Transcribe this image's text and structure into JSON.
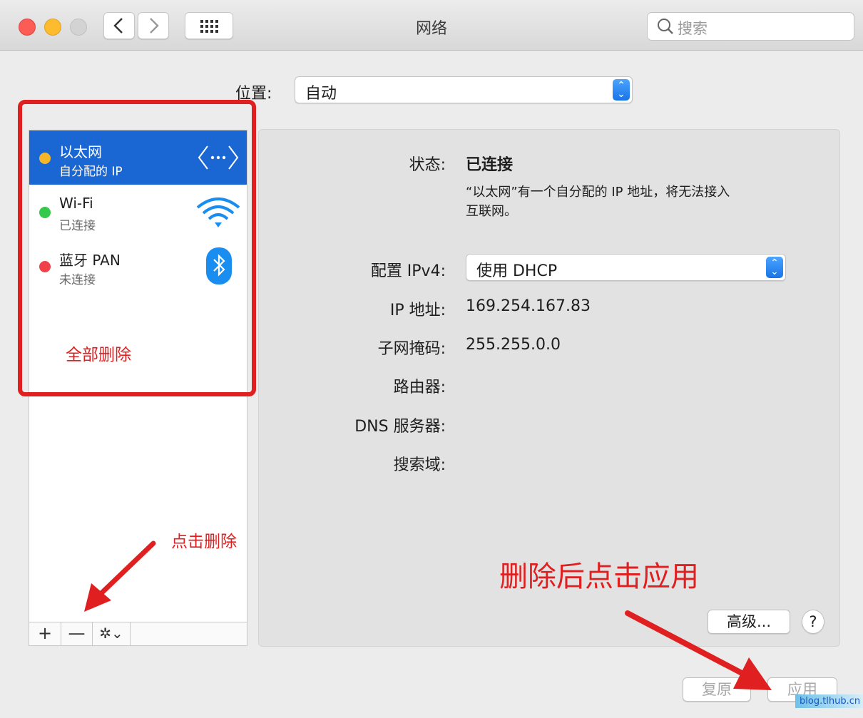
{
  "window": {
    "title": "网络"
  },
  "toolbar": {
    "search_placeholder": "搜索"
  },
  "location": {
    "label": "位置:",
    "value": "自动"
  },
  "services": [
    {
      "name": "以太网",
      "status": "自分配的 IP",
      "dot_color": "#f5b62a",
      "icon": "ethernet-icon"
    },
    {
      "name": "Wi-Fi",
      "status": "已连接",
      "dot_color": "#34c94a",
      "icon": "wifi-icon"
    },
    {
      "name": "蓝牙 PAN",
      "status": "未连接",
      "dot_color": "#f0414a",
      "icon": "bluetooth-icon"
    }
  ],
  "list_tools": {
    "add": "+",
    "remove": "—",
    "gear": "✲⌄"
  },
  "details": {
    "status_label": "状态:",
    "status_value": "已连接",
    "status_desc_line1": "“以太网”有一个自分配的 IP 地址，将无法接入",
    "status_desc_line2": "互联网。",
    "config_label": "配置 IPv4:",
    "config_value": "使用 DHCP",
    "ip_label": "IP 地址:",
    "ip_value": "169.254.167.83",
    "subnet_label": "子网掩码:",
    "subnet_value": "255.255.0.0",
    "router_label": "路由器:",
    "dns_label": "DNS 服务器:",
    "search_domain_label": "搜索域:"
  },
  "buttons": {
    "advanced": "高级...",
    "help": "?",
    "revert": "复原",
    "apply": "应用"
  },
  "annotations": {
    "delete_all": "全部删除",
    "click_delete": "点击删除",
    "apply_after": "删除后点击应用",
    "color": "#e02020"
  },
  "watermark": "blog.tlhub.cn"
}
